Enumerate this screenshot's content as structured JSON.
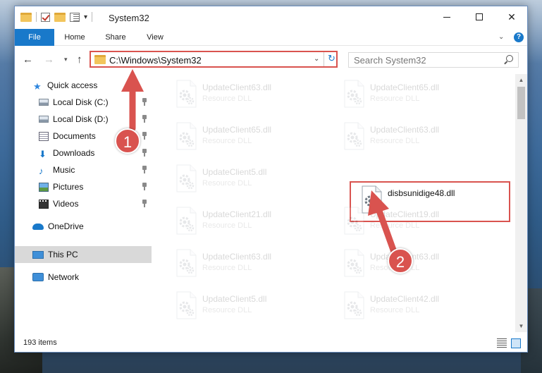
{
  "window": {
    "title": "System32",
    "controls": {
      "minimize": "minimize-icon",
      "maximize": "maximize-icon",
      "close": "✕"
    }
  },
  "ribbon": {
    "tabs": [
      {
        "label": "File"
      },
      {
        "label": "Home"
      },
      {
        "label": "Share"
      },
      {
        "label": "View"
      }
    ],
    "help_label": "?"
  },
  "navigation": {
    "back_glyph": "←",
    "forward_glyph": "→",
    "recent_glyph": "▾",
    "up_glyph": "↑",
    "address": "C:\\Windows\\System32",
    "refresh_glyph": "↻",
    "search_placeholder": "Search System32"
  },
  "sidebar": {
    "items": [
      {
        "label": "Quick access",
        "icon": "star-icon",
        "pinned": false
      },
      {
        "label": "Local Disk (C:)",
        "icon": "disk-icon",
        "pinned": true
      },
      {
        "label": "Local Disk (D:)",
        "icon": "disk-icon",
        "pinned": true
      },
      {
        "label": "Documents",
        "icon": "documents-icon",
        "pinned": true
      },
      {
        "label": "Downloads",
        "icon": "download-icon",
        "pinned": true
      },
      {
        "label": "Music",
        "icon": "music-icon",
        "pinned": true
      },
      {
        "label": "Pictures",
        "icon": "pictures-icon",
        "pinned": true
      },
      {
        "label": "Videos",
        "icon": "videos-icon",
        "pinned": true
      },
      {
        "label": "OneDrive",
        "icon": "cloud-icon",
        "pinned": false
      },
      {
        "label": "This PC",
        "icon": "pc-icon",
        "pinned": false,
        "selected": true
      },
      {
        "label": "Network",
        "icon": "network-icon",
        "pinned": false
      }
    ]
  },
  "files": [
    {
      "name": "UpdateClient63.dll",
      "type": "Resource DLL",
      "faded": true
    },
    {
      "name": "UpdateClient65.dll",
      "type": "Resource DLL",
      "faded": true
    },
    {
      "name": "UpdateClient65.dll",
      "type": "Resource DLL",
      "faded": true
    },
    {
      "name": "UpdateClient63.dll",
      "type": "Resource DLL",
      "faded": true
    },
    {
      "name": "UpdateClient5.dll",
      "type": "Resource DLL",
      "faded": true
    },
    {
      "name": "disbsunidige48.dll",
      "type": "",
      "faded": false,
      "highlighted": true
    },
    {
      "name": "UpdateClient21.dll",
      "type": "Resource DLL",
      "faded": true
    },
    {
      "name": "UpdateClient19.dll",
      "type": "Resource DLL",
      "faded": true
    },
    {
      "name": "UpdateClient63.dll",
      "type": "Resource DLL",
      "faded": true
    },
    {
      "name": "UpdateClient63.dll",
      "type": "Resource DLL",
      "faded": true
    },
    {
      "name": "UpdateClient5.dll",
      "type": "Resource DLL",
      "faded": true
    },
    {
      "name": "UpdateClient42.dll",
      "type": "Resource DLL",
      "faded": true
    }
  ],
  "status": {
    "item_count": "193 items"
  },
  "annotations": [
    {
      "label": "1"
    },
    {
      "label": "2"
    }
  ],
  "colors": {
    "accent": "#1979ca",
    "highlight": "#d9534f"
  }
}
